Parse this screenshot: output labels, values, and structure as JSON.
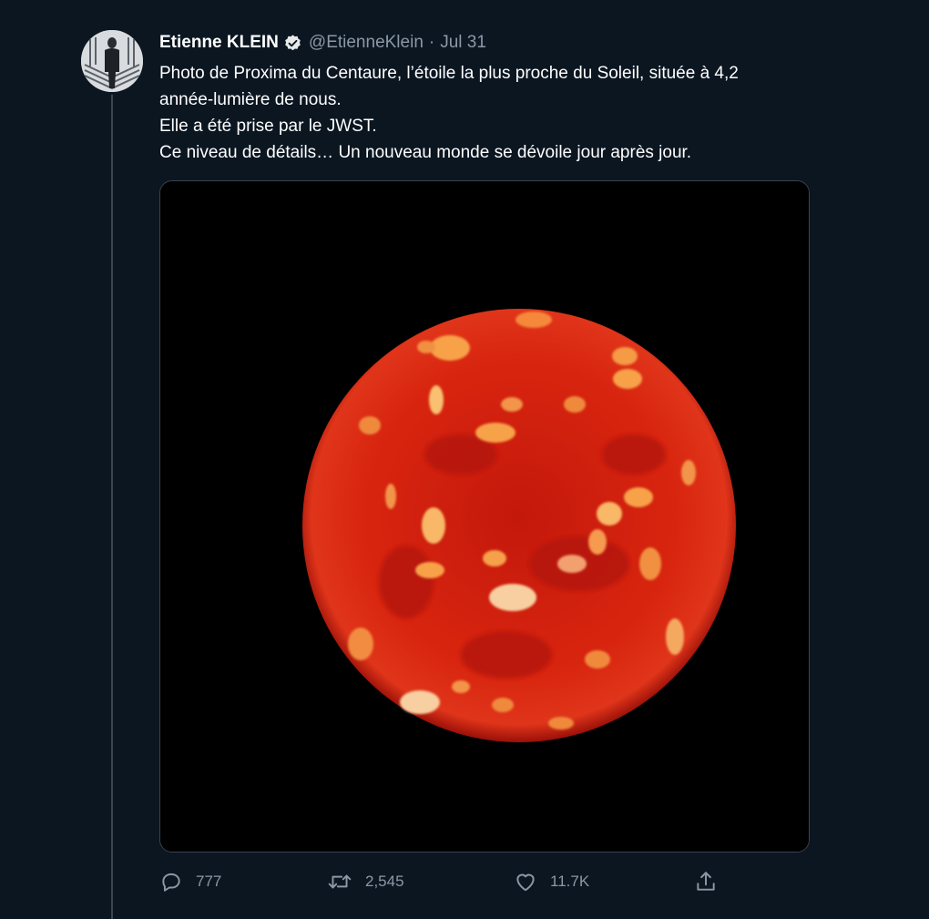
{
  "tweet": {
    "author_name": "Etienne KLEIN",
    "handle": "@EtienneKlein",
    "separator": "·",
    "date": "Jul 31",
    "text_lines": [
      "Photo de Proxima du Centaure, l’étoile la plus proche du Soleil, située à 4,2",
      "année-lumière de nous.",
      "Elle a été prise par le JWST.",
      "Ce niveau de détails… Un nouveau monde se dévoile jour après jour."
    ]
  },
  "actions": {
    "replies": "777",
    "retweets": "2,545",
    "likes": "11.7K"
  },
  "icons": {
    "verified": "verified-badge-icon",
    "reply": "reply-icon",
    "retweet": "retweet-icon",
    "like": "heart-icon",
    "share": "share-icon"
  },
  "colors": {
    "background": "#0b1621",
    "text": "#ffffff",
    "muted": "#8b98a5",
    "media_background": "#000000",
    "star_red": "#d4200f"
  }
}
